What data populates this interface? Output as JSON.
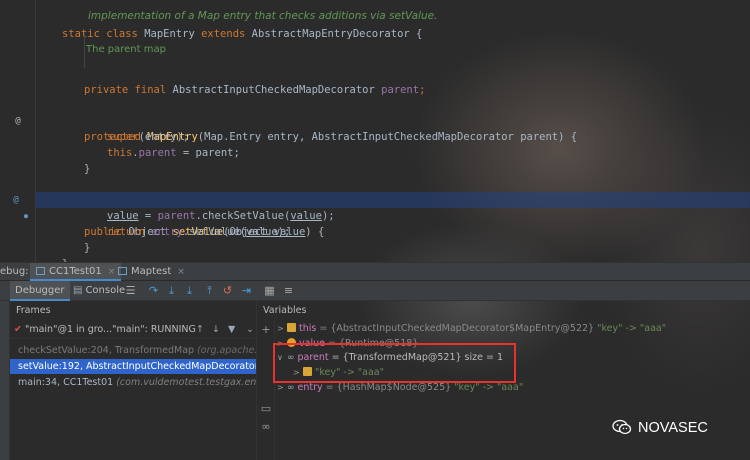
{
  "editor": {
    "top_comment": "implementation of a Map entry that checks additions via setValue.",
    "doc_comment": "The parent map",
    "line_numbers": [
      "",
      "",
      "",
      "",
      "",
      "",
      "",
      "",
      "",
      "",
      "",
      "",
      "",
      "",
      ""
    ],
    "code": {
      "l1": {
        "mod": "static class ",
        "name": "MapEntry",
        "ext": " extends ",
        "base": "AbstractMapEntryDecorator {"
      },
      "l3": {
        "mod": "private final ",
        "type": "AbstractInputCheckedMapDecorator ",
        "field": "parent",
        "end": ";"
      },
      "l5": {
        "mod": "protected ",
        "name": "MapEntry",
        "params": "(Map.Entry entry, AbstractInputCheckedMapDecorator parent) {"
      },
      "l6": {
        "kw": "super",
        "rest": "(entry);"
      },
      "l7": {
        "kw": "this",
        "dot": ".",
        "field": "parent",
        "rest": " = parent;"
      },
      "l8": {
        "rest": "}"
      },
      "l10": {
        "mod": "public ",
        "type": "Object ",
        "name": "setValue",
        "params_a": "(Object ",
        "param": "value",
        "params_b": ") {"
      },
      "l11": {
        "a": "value",
        "b": " = ",
        "c": "parent",
        "d": ".checkSetValue(",
        "e": "value",
        "f": ");"
      },
      "l12": {
        "kw": "return ",
        "a": "entry",
        "b": ".setValue(",
        "c": "value",
        "d": ");"
      },
      "l13": {
        "rest": "}"
      },
      "l14": {
        "rest": "}"
      }
    },
    "gutter_marks": {
      "at": "@",
      "bp": "●"
    }
  },
  "debug_bar": {
    "label": "ebug:",
    "tabs": [
      {
        "label": "CC1Test01"
      },
      {
        "label": "Maptest"
      }
    ],
    "close": "×"
  },
  "toolbar": {
    "tabs": [
      "Debugger",
      "Console"
    ],
    "icons": [
      "list-icon",
      "step-over-icon",
      "step-into-icon",
      "force-step-into-icon",
      "step-out-icon",
      "drop-frame-icon",
      "run-to-cursor-icon",
      "evaluate-icon"
    ]
  },
  "frames": {
    "header": "Frames",
    "thread": "\"main\"@1 in gro...\"main\": RUNNING",
    "rows": [
      {
        "method": "checkSetValue:204, TransformedMap ",
        "pkg": "(org.apache.comm"
      },
      {
        "method": "setValue:192, AbstractInputCheckedMapDecorator$MapE",
        "pkg": ""
      },
      {
        "method": "main:34, CC1Test01 ",
        "pkg": "(com.vuldemotest.testgax.entity)"
      }
    ]
  },
  "variables": {
    "header": "Variables",
    "rows": [
      {
        "name": "this",
        "value": " = {AbstractInputCheckedMapDecorator$MapEntry@522} ",
        "str": "\"key\" -> \"aaa\""
      },
      {
        "name": "value",
        "value": " = {Runtime@518}",
        "str": ""
      },
      {
        "name": "parent",
        "value": " = {TransformedMap@521}  size = 1",
        "str": ""
      },
      {
        "name": "",
        "value": "",
        "str": "\"key\" -> \"aaa\""
      },
      {
        "name": "entry",
        "value": " = {HashMap$Node@525} ",
        "str": "\"key\" -> \"aaa\""
      }
    ]
  },
  "watermark": {
    "text": "NOVASEC"
  }
}
